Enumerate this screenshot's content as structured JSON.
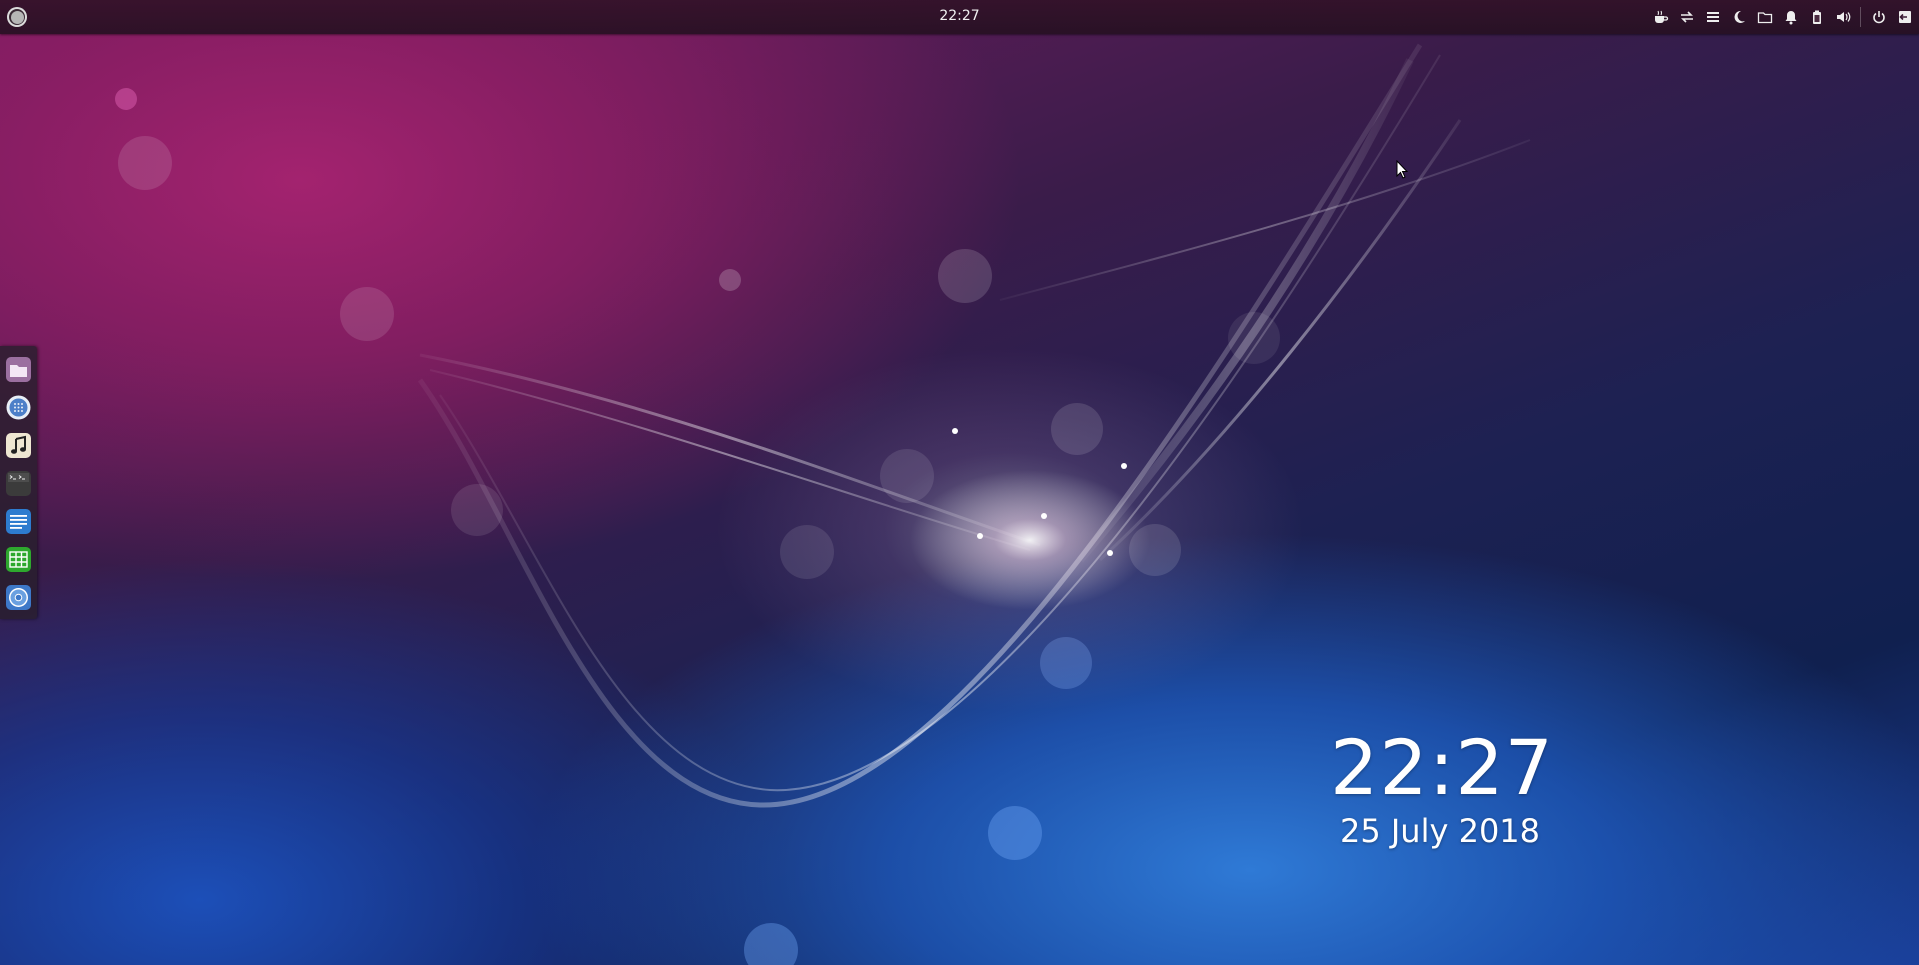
{
  "panel": {
    "clock": "22:27",
    "tray_icons": [
      "coffee-cup-icon",
      "sync-arrows-icon",
      "hamburger-menu-icon",
      "moon-icon",
      "folder-icon",
      "bell-icon",
      "battery-icon",
      "volume-icon",
      "power-icon",
      "logout-icon"
    ]
  },
  "dock": {
    "items": [
      "files",
      "app-grid",
      "music-player",
      "terminal",
      "text-editor",
      "spreadsheet",
      "chromium-browser"
    ]
  },
  "desktop_clock": {
    "time": "22:27",
    "date": "25 July 2018"
  },
  "colors": {
    "panel_bg": "#2a1224",
    "wallpaper_magenta": "#a3236f",
    "wallpaper_blue": "#2f7ad6"
  }
}
